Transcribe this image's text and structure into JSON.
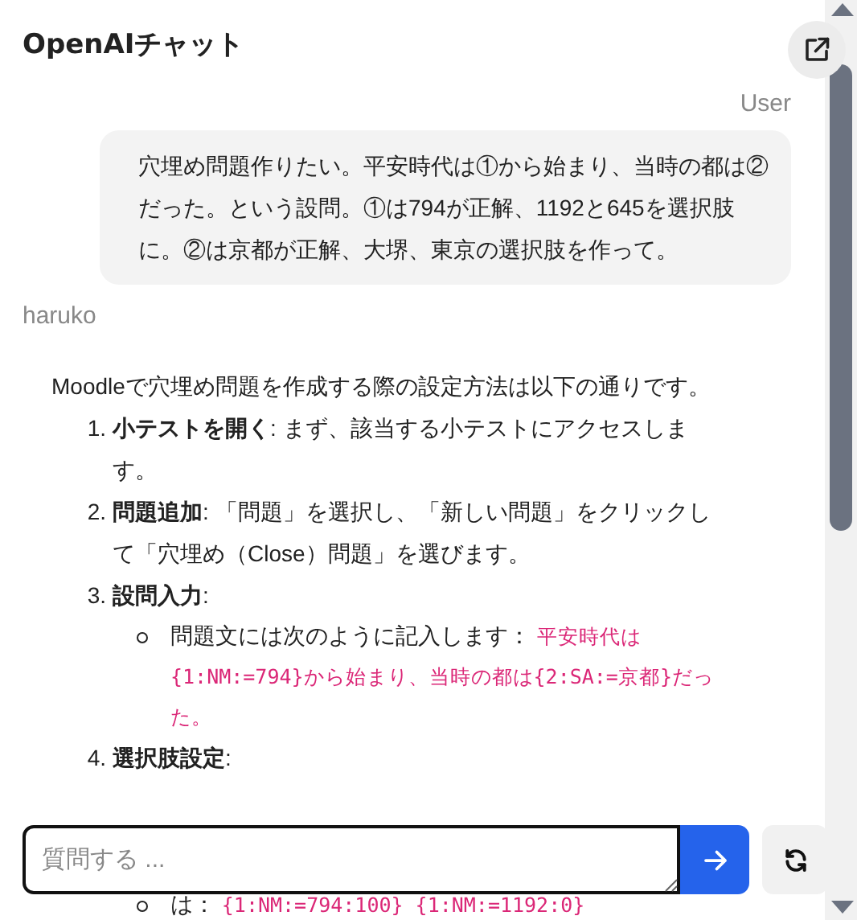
{
  "header": {
    "title": "OpenAIチャット"
  },
  "messages": [
    {
      "kind": "user",
      "sender": "User",
      "text": "穴埋め問題作りたい。平安時代は①から始まり、当時の都は②だった。という設問。①は794が正解、1192と645を選択肢に。②は京都が正解、大堺、東京の選択肢を作って。"
    },
    {
      "kind": "assistant",
      "sender": "haruko",
      "intro": "Moodleで穴埋め問題を作成する際の設定方法は以下の通りです。",
      "steps": [
        {
          "number": "1.",
          "title": "小テストを開く",
          "text": ": まず、該当する小テストにアクセスします。"
        },
        {
          "number": "2.",
          "title": "問題追加",
          "text": ": 「問題」を選択し、「新しい問題」をクリックして「穴埋め（Close）問題」を選びます。"
        },
        {
          "number": "3.",
          "title": "設問入力",
          "text": ":",
          "subitems": [
            [
              {
                "kind": "text",
                "text": "問題文には次のように記入します： "
              },
              {
                "kind": "code",
                "text": "平安時代は{1:NM:=794}から始まり、当時の都は{2:SA:=京都}だった。"
              }
            ]
          ]
        },
        {
          "number": "4.",
          "title": "選択肢設定",
          "text": ":",
          "subitems": [
            [
              {
                "kind": "text",
                "text": "は： "
              },
              {
                "kind": "code",
                "text": "{1:NM:=794:100} {1:NM:=1192:0}"
              }
            ]
          ]
        }
      ]
    }
  ],
  "composer": {
    "placeholder": "質問する ..."
  }
}
